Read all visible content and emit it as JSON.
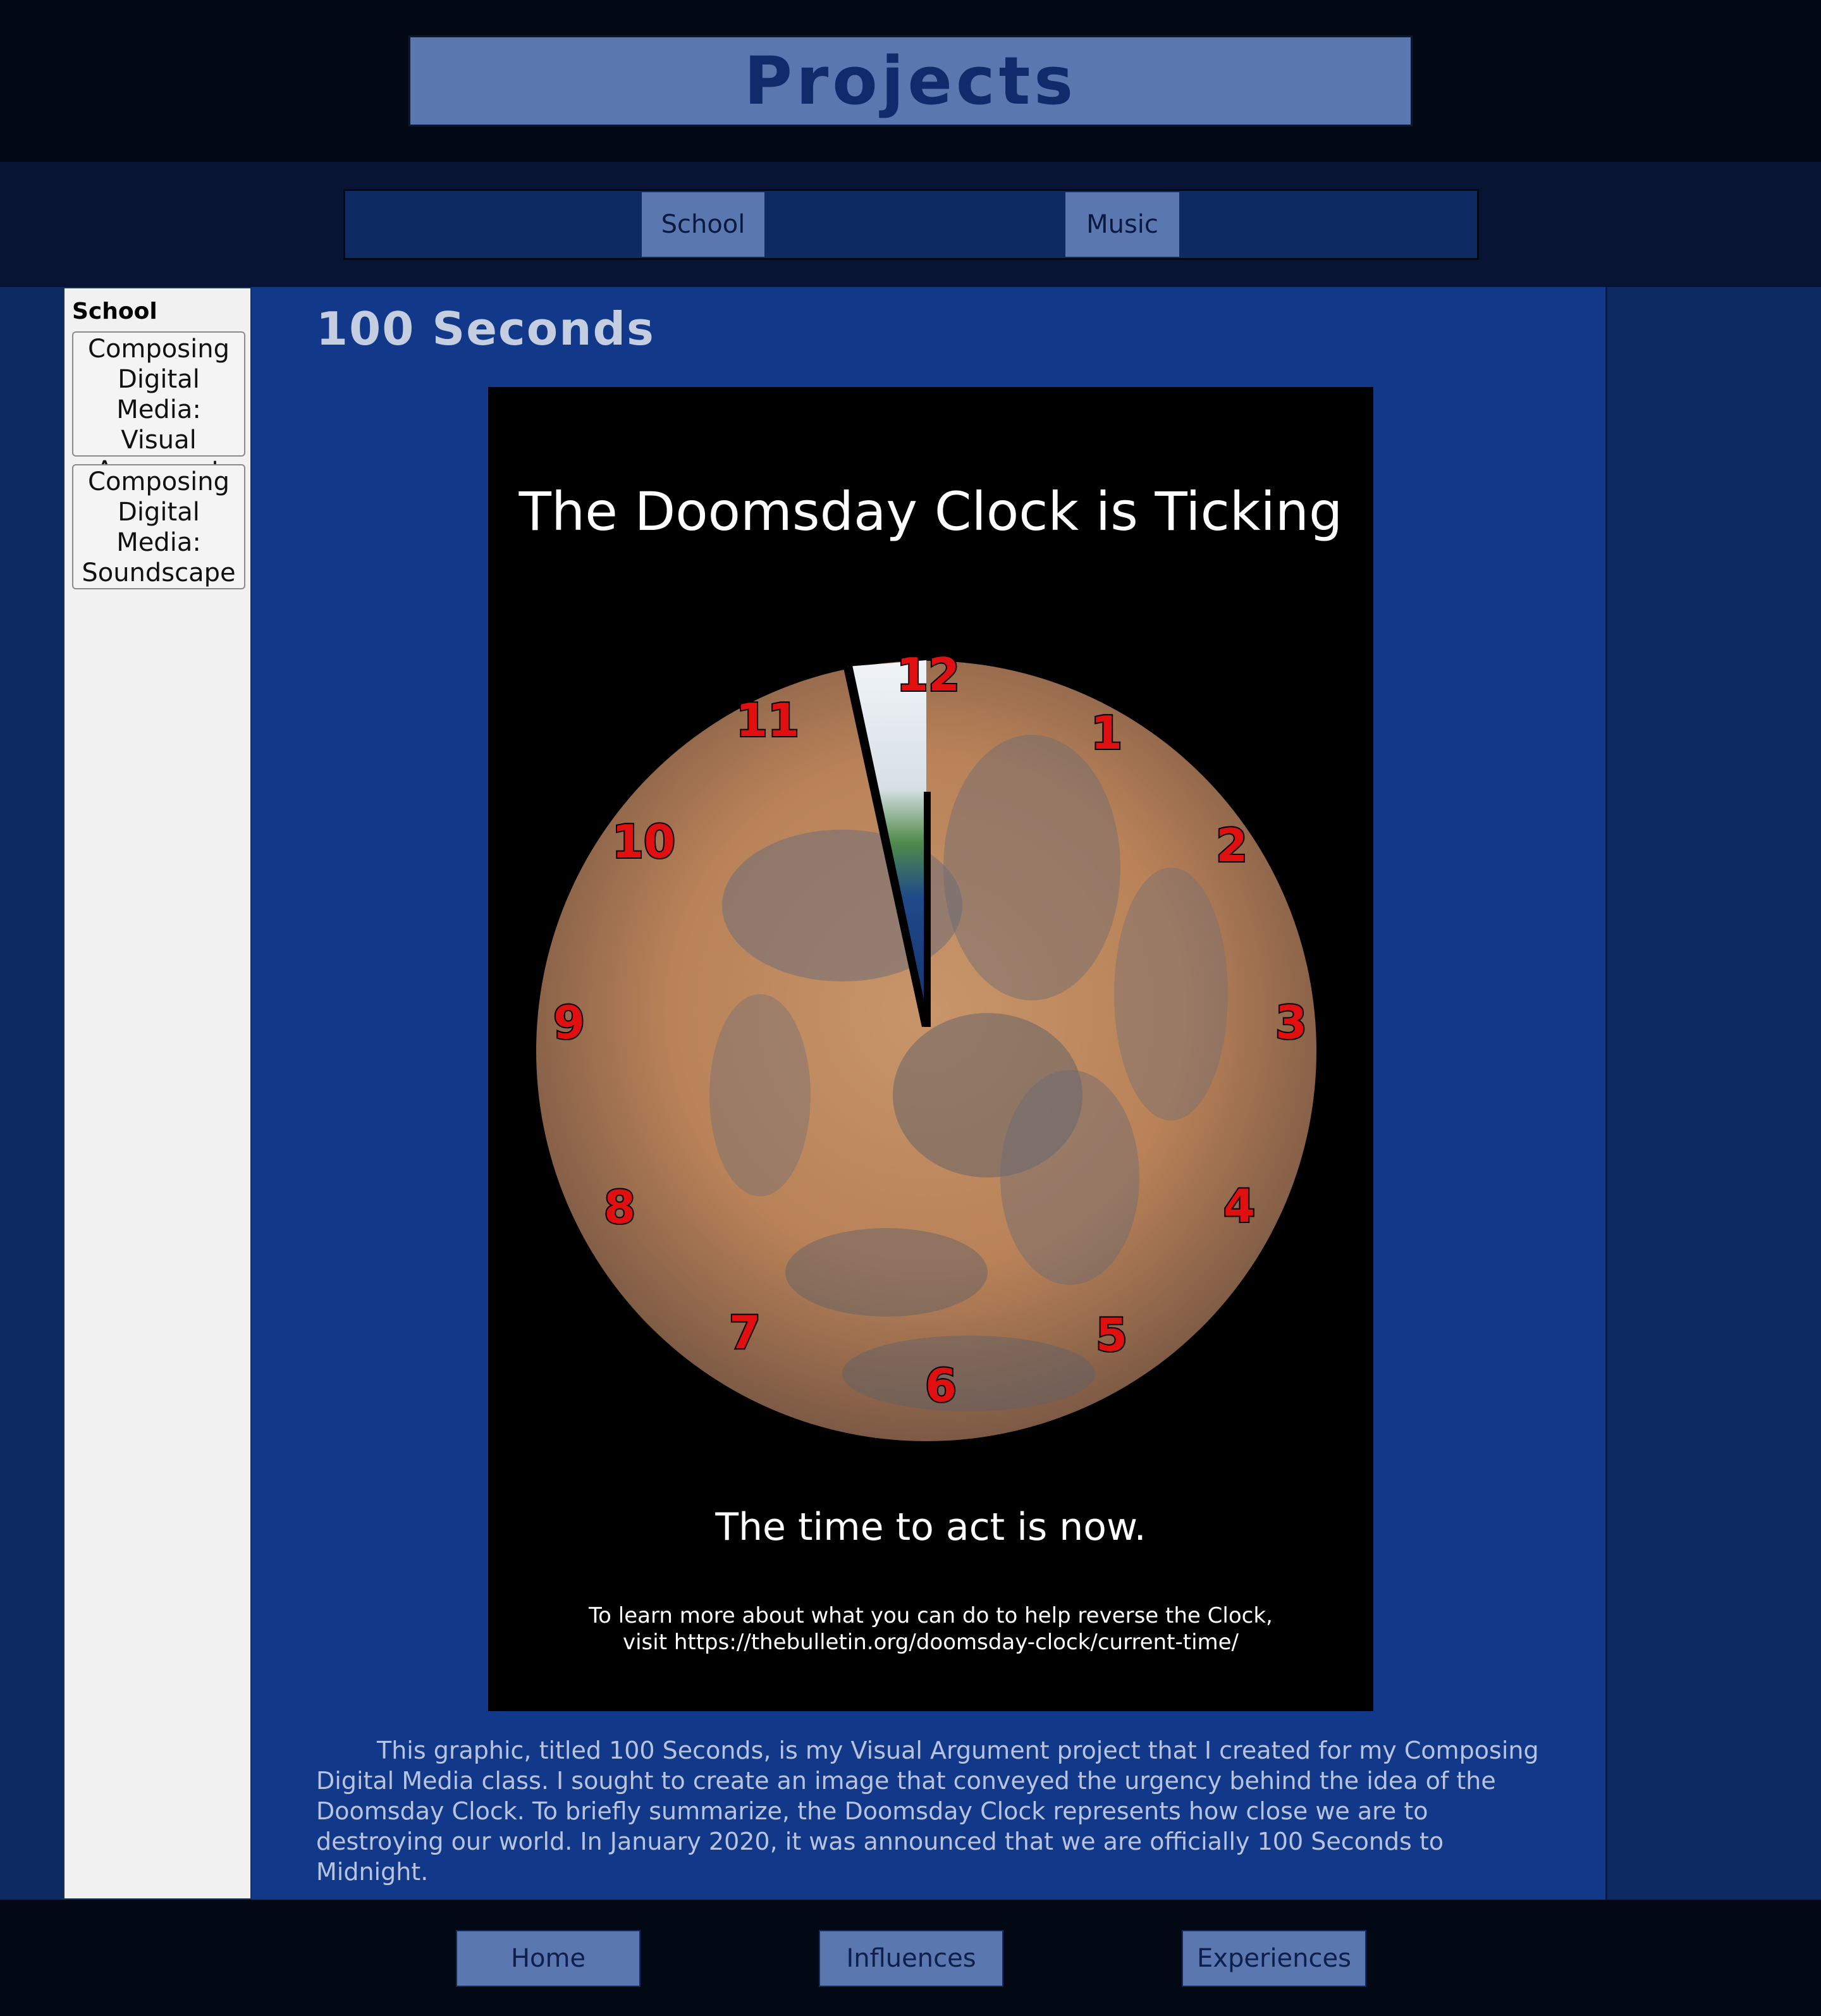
{
  "header": {
    "title": "Projects"
  },
  "subnav": {
    "items": [
      {
        "label": "School"
      },
      {
        "label": "Music"
      }
    ]
  },
  "sidebar": {
    "heading": "School",
    "items": [
      {
        "label": "Composing Digital Media: Visual Argument"
      },
      {
        "label": "Composing Digital Media: Soundscape"
      }
    ]
  },
  "main": {
    "heading": "100 Seconds",
    "poster": {
      "title": "The Doomsday Clock is Ticking",
      "numerals": [
        "12",
        "1",
        "2",
        "3",
        "4",
        "5",
        "6",
        "7",
        "8",
        "9",
        "10",
        "11"
      ],
      "tagline": "The time to act is now.",
      "footnote_line1": "To learn more about what you can do to help reverse the Clock,",
      "footnote_line2": "visit https://thebulletin.org/doomsday-clock/current-time/"
    },
    "description": "This graphic, titled 100 Seconds, is my Visual Argument project that I created for my Composing Digital Media class. I sought to create an image that conveyed the urgency behind the idea of the Doomsday Clock. To briefly summarize, the Doomsday Clock represents how close we are to destroying our world. In January 2020, it was announced that we are officially 100 Seconds to Midnight."
  },
  "footer": {
    "links": [
      {
        "label": "Home"
      },
      {
        "label": "Influences"
      },
      {
        "label": "Experiences"
      }
    ]
  },
  "colors": {
    "header_bg": "#020814",
    "nav_button": "#5b77b0",
    "main_bg": "#12388a",
    "title_text": "#112a6b",
    "numeral": "#e01010"
  }
}
